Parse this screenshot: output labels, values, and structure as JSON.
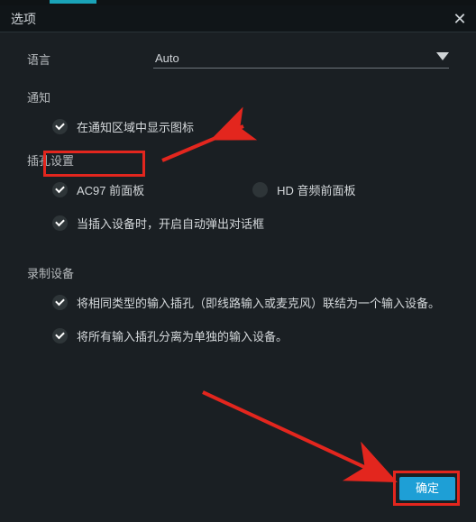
{
  "header": {
    "title": "选项"
  },
  "language": {
    "label": "语言",
    "selected": "Auto"
  },
  "notify": {
    "header": "通知",
    "show_tray": "在通知区域中显示图标"
  },
  "jack": {
    "header": "插孔设置",
    "ac97": "AC97 前面板",
    "hd": "HD 音频前面板",
    "auto_popup": "当插入设备时，开启自动弹出对话框"
  },
  "record": {
    "header": "录制设备",
    "combine": "将相同类型的输入插孔（即线路输入或麦克风）联结为一个输入设备。",
    "separate": "将所有输入插孔分离为单独的输入设备。"
  },
  "buttons": {
    "ok": "确定"
  }
}
